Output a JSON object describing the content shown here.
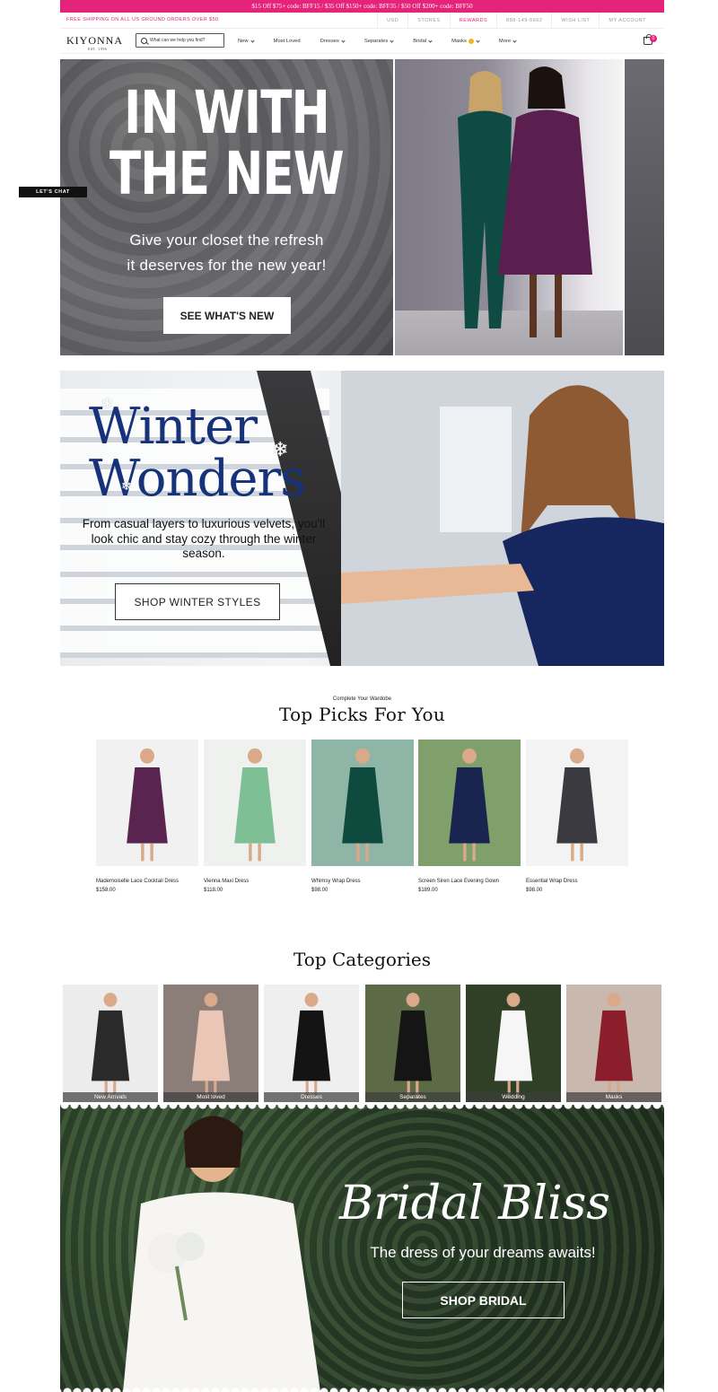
{
  "promo_bar": {
    "text": "$15 Off $75+ code: BFF15  /  $35 Off $150+ code: BFF35  /  $50 Off $200+ code: BFF50"
  },
  "utility_bar": {
    "shipping": "FREE SHIPPING ON ALL US GROUND ORDERS OVER $50",
    "currency": "USD",
    "stores": "STORES",
    "rewards": "REWARDS",
    "phone": "888-149-6662",
    "wishlist": "WISH LIST",
    "account": "MY ACCOUNT"
  },
  "header": {
    "logo": "KIYONNA",
    "logo_sub": "EST. 1996",
    "search_placeholder": "What can we help you find?",
    "cart_count": "0",
    "menu": [
      "New",
      "Most Loved",
      "Dresses",
      "Separates",
      "Bridal",
      "Masks",
      "More"
    ]
  },
  "hero1": {
    "title_line1": "IN WITH",
    "title_line2": "THE NEW",
    "subtitle_line1": "Give your closet the refresh",
    "subtitle_line2": "it deserves for the new year!",
    "button": "SEE WHAT'S NEW"
  },
  "chat": {
    "label": "LET'S CHAT"
  },
  "hero2": {
    "title_line1": "Winter",
    "title_line2": "Wonders",
    "subtitle": "From casual layers to luxurious velvets, you'll look chic and stay cozy through the winter season.",
    "button": "SHOP WINTER STYLES"
  },
  "top_picks": {
    "kicker": "Complete Your Wardobe",
    "title": "Top Picks For You",
    "items": [
      {
        "name": "Mademoiselle Lace Cocktail Dress",
        "price": "$158.00",
        "color": "#5a2450",
        "bg": "#f1f1f2"
      },
      {
        "name": "Vienna Maxi Dress",
        "price": "$118.00",
        "color": "#7fbf95",
        "bg": "#eef1ee"
      },
      {
        "name": "Whimsy Wrap Dress",
        "price": "$98.00",
        "color": "#0e4a3d",
        "bg": "#8fb5a6"
      },
      {
        "name": "Screen Siren Lace Evening Gown",
        "price": "$189.00",
        "color": "#19244f",
        "bg": "#7fa06a"
      },
      {
        "name": "Essential Wrap Dress",
        "price": "$98.00",
        "color": "#3a3a40",
        "bg": "#f3f3f3"
      }
    ]
  },
  "top_categories": {
    "title": "Top Categories",
    "items": [
      {
        "label": "New Arrivals",
        "color": "#2a2a2a",
        "bg": "#ececec"
      },
      {
        "label": "Most loved",
        "color": "#e9c6b6",
        "bg": "#8b7e78"
      },
      {
        "label": "Dresses",
        "color": "#141414",
        "bg": "#efefef"
      },
      {
        "label": "Separates",
        "color": "#151515",
        "bg": "#5c6a45"
      },
      {
        "label": "Wedding",
        "color": "#f6f6f6",
        "bg": "#2f4027"
      },
      {
        "label": "Masks",
        "color": "#8a1e2a",
        "bg": "#c9b8ad"
      }
    ]
  },
  "bridal": {
    "title": "Bridal Bliss",
    "subtitle": "The dress of your dreams awaits!",
    "button": "SHOP BRIDAL"
  }
}
